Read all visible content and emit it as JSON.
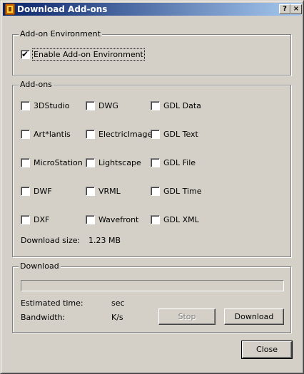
{
  "window": {
    "title": "Download Add-ons",
    "help_label": "?",
    "close_label": "×"
  },
  "environment": {
    "legend": "Add-on Environment",
    "enable_label": "Enable Add-on Environment",
    "enable_checked": true
  },
  "addons": {
    "legend": "Add-ons",
    "col1": [
      "3DStudio",
      "Art*lantis",
      "MicroStation",
      "DWF",
      "DXF"
    ],
    "col2": [
      "DWG",
      "ElectricImage",
      "Lightscape",
      "VRML",
      "Wavefront"
    ],
    "col3": [
      "GDL Data",
      "GDL Text",
      "GDL File",
      "GDL Time",
      "GDL XML"
    ],
    "download_size_label": "Download size:",
    "download_size_value": "1.23 MB"
  },
  "download": {
    "legend": "Download",
    "progress": 0,
    "estimated_time_label": "Estimated time:",
    "estimated_time_unit": "sec",
    "bandwidth_label": "Bandwidth:",
    "bandwidth_unit": "K/s",
    "stop_label": "Stop",
    "download_label": "Download"
  },
  "close_label": "Close"
}
